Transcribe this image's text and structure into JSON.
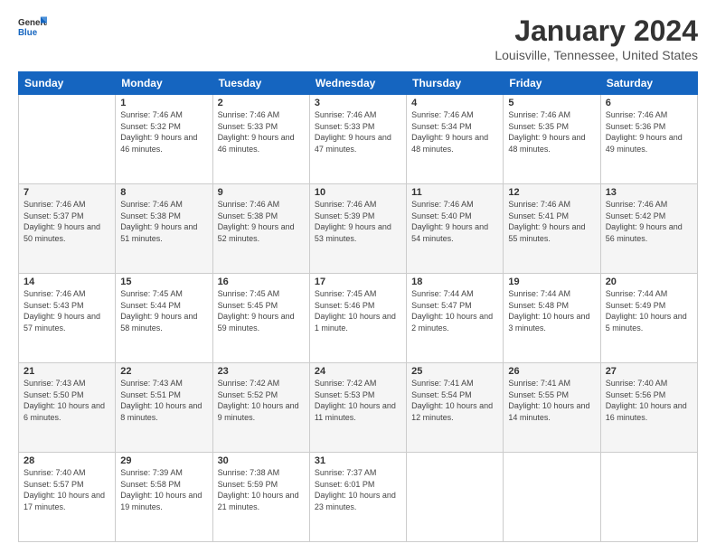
{
  "header": {
    "logo_line1": "General",
    "logo_line2": "Blue",
    "title": "January 2024",
    "subtitle": "Louisville, Tennessee, United States"
  },
  "weekdays": [
    "Sunday",
    "Monday",
    "Tuesday",
    "Wednesday",
    "Thursday",
    "Friday",
    "Saturday"
  ],
  "weeks": [
    [
      {
        "day": "",
        "sunrise": "",
        "sunset": "",
        "daylight": ""
      },
      {
        "day": "1",
        "sunrise": "Sunrise: 7:46 AM",
        "sunset": "Sunset: 5:32 PM",
        "daylight": "Daylight: 9 hours and 46 minutes."
      },
      {
        "day": "2",
        "sunrise": "Sunrise: 7:46 AM",
        "sunset": "Sunset: 5:33 PM",
        "daylight": "Daylight: 9 hours and 46 minutes."
      },
      {
        "day": "3",
        "sunrise": "Sunrise: 7:46 AM",
        "sunset": "Sunset: 5:33 PM",
        "daylight": "Daylight: 9 hours and 47 minutes."
      },
      {
        "day": "4",
        "sunrise": "Sunrise: 7:46 AM",
        "sunset": "Sunset: 5:34 PM",
        "daylight": "Daylight: 9 hours and 48 minutes."
      },
      {
        "day": "5",
        "sunrise": "Sunrise: 7:46 AM",
        "sunset": "Sunset: 5:35 PM",
        "daylight": "Daylight: 9 hours and 48 minutes."
      },
      {
        "day": "6",
        "sunrise": "Sunrise: 7:46 AM",
        "sunset": "Sunset: 5:36 PM",
        "daylight": "Daylight: 9 hours and 49 minutes."
      }
    ],
    [
      {
        "day": "7",
        "sunrise": "Sunrise: 7:46 AM",
        "sunset": "Sunset: 5:37 PM",
        "daylight": "Daylight: 9 hours and 50 minutes."
      },
      {
        "day": "8",
        "sunrise": "Sunrise: 7:46 AM",
        "sunset": "Sunset: 5:38 PM",
        "daylight": "Daylight: 9 hours and 51 minutes."
      },
      {
        "day": "9",
        "sunrise": "Sunrise: 7:46 AM",
        "sunset": "Sunset: 5:38 PM",
        "daylight": "Daylight: 9 hours and 52 minutes."
      },
      {
        "day": "10",
        "sunrise": "Sunrise: 7:46 AM",
        "sunset": "Sunset: 5:39 PM",
        "daylight": "Daylight: 9 hours and 53 minutes."
      },
      {
        "day": "11",
        "sunrise": "Sunrise: 7:46 AM",
        "sunset": "Sunset: 5:40 PM",
        "daylight": "Daylight: 9 hours and 54 minutes."
      },
      {
        "day": "12",
        "sunrise": "Sunrise: 7:46 AM",
        "sunset": "Sunset: 5:41 PM",
        "daylight": "Daylight: 9 hours and 55 minutes."
      },
      {
        "day": "13",
        "sunrise": "Sunrise: 7:46 AM",
        "sunset": "Sunset: 5:42 PM",
        "daylight": "Daylight: 9 hours and 56 minutes."
      }
    ],
    [
      {
        "day": "14",
        "sunrise": "Sunrise: 7:46 AM",
        "sunset": "Sunset: 5:43 PM",
        "daylight": "Daylight: 9 hours and 57 minutes."
      },
      {
        "day": "15",
        "sunrise": "Sunrise: 7:45 AM",
        "sunset": "Sunset: 5:44 PM",
        "daylight": "Daylight: 9 hours and 58 minutes."
      },
      {
        "day": "16",
        "sunrise": "Sunrise: 7:45 AM",
        "sunset": "Sunset: 5:45 PM",
        "daylight": "Daylight: 9 hours and 59 minutes."
      },
      {
        "day": "17",
        "sunrise": "Sunrise: 7:45 AM",
        "sunset": "Sunset: 5:46 PM",
        "daylight": "Daylight: 10 hours and 1 minute."
      },
      {
        "day": "18",
        "sunrise": "Sunrise: 7:44 AM",
        "sunset": "Sunset: 5:47 PM",
        "daylight": "Daylight: 10 hours and 2 minutes."
      },
      {
        "day": "19",
        "sunrise": "Sunrise: 7:44 AM",
        "sunset": "Sunset: 5:48 PM",
        "daylight": "Daylight: 10 hours and 3 minutes."
      },
      {
        "day": "20",
        "sunrise": "Sunrise: 7:44 AM",
        "sunset": "Sunset: 5:49 PM",
        "daylight": "Daylight: 10 hours and 5 minutes."
      }
    ],
    [
      {
        "day": "21",
        "sunrise": "Sunrise: 7:43 AM",
        "sunset": "Sunset: 5:50 PM",
        "daylight": "Daylight: 10 hours and 6 minutes."
      },
      {
        "day": "22",
        "sunrise": "Sunrise: 7:43 AM",
        "sunset": "Sunset: 5:51 PM",
        "daylight": "Daylight: 10 hours and 8 minutes."
      },
      {
        "day": "23",
        "sunrise": "Sunrise: 7:42 AM",
        "sunset": "Sunset: 5:52 PM",
        "daylight": "Daylight: 10 hours and 9 minutes."
      },
      {
        "day": "24",
        "sunrise": "Sunrise: 7:42 AM",
        "sunset": "Sunset: 5:53 PM",
        "daylight": "Daylight: 10 hours and 11 minutes."
      },
      {
        "day": "25",
        "sunrise": "Sunrise: 7:41 AM",
        "sunset": "Sunset: 5:54 PM",
        "daylight": "Daylight: 10 hours and 12 minutes."
      },
      {
        "day": "26",
        "sunrise": "Sunrise: 7:41 AM",
        "sunset": "Sunset: 5:55 PM",
        "daylight": "Daylight: 10 hours and 14 minutes."
      },
      {
        "day": "27",
        "sunrise": "Sunrise: 7:40 AM",
        "sunset": "Sunset: 5:56 PM",
        "daylight": "Daylight: 10 hours and 16 minutes."
      }
    ],
    [
      {
        "day": "28",
        "sunrise": "Sunrise: 7:40 AM",
        "sunset": "Sunset: 5:57 PM",
        "daylight": "Daylight: 10 hours and 17 minutes."
      },
      {
        "day": "29",
        "sunrise": "Sunrise: 7:39 AM",
        "sunset": "Sunset: 5:58 PM",
        "daylight": "Daylight: 10 hours and 19 minutes."
      },
      {
        "day": "30",
        "sunrise": "Sunrise: 7:38 AM",
        "sunset": "Sunset: 5:59 PM",
        "daylight": "Daylight: 10 hours and 21 minutes."
      },
      {
        "day": "31",
        "sunrise": "Sunrise: 7:37 AM",
        "sunset": "Sunset: 6:01 PM",
        "daylight": "Daylight: 10 hours and 23 minutes."
      },
      {
        "day": "",
        "sunrise": "",
        "sunset": "",
        "daylight": ""
      },
      {
        "day": "",
        "sunrise": "",
        "sunset": "",
        "daylight": ""
      },
      {
        "day": "",
        "sunrise": "",
        "sunset": "",
        "daylight": ""
      }
    ]
  ]
}
